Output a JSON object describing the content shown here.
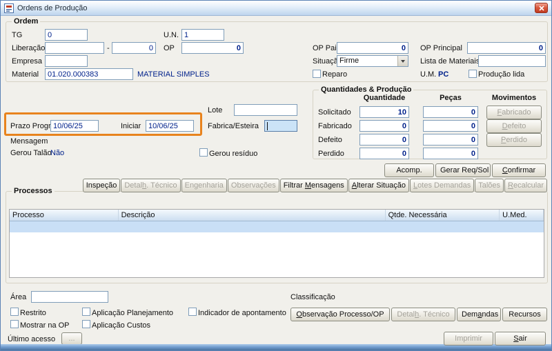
{
  "window": {
    "title": "Ordens de Produção"
  },
  "colors": {
    "annotation_highlight": "#E8831D",
    "field_value_text": "#00218B",
    "focused_field_bg": "#CBE3F7",
    "selected_row_bg": "#C9DFF6"
  },
  "ordem": {
    "label": "Ordem",
    "tg_label": "TG",
    "tg_value": "0",
    "un_label": "U.N.",
    "un_value": "1",
    "liberacao_label": "Liberação",
    "liberacao_value1": "",
    "liberacao_sep": "-",
    "liberacao_value2": "0",
    "op_label": "OP",
    "op_value": "0",
    "op_pai_label": "OP Pai",
    "op_pai_value": "0",
    "op_principal_label": "OP Principal",
    "op_principal_value": "0",
    "empresa_label": "Empresa",
    "empresa_value": "",
    "situacao_label": "Situação",
    "situacao_value": "Firme",
    "lista_label": "Lista de Materiais",
    "lista_value": "",
    "material_label": "Material",
    "material_value": "01.020.000383",
    "material_desc": "MATERIAL SIMPLES",
    "reparo_label": "Reparo",
    "um_label": "U.M.",
    "um_value": "PC",
    "producao_lida_label": "Produção lida"
  },
  "detalhes": {
    "lote_label": "Lote",
    "lote_value": "",
    "fabrica_label": "Fabrica/Esteira",
    "fabrica_value": "",
    "prazo_label": "Prazo Progr.",
    "prazo_value": "10/06/25",
    "iniciar_label": "Iniciar",
    "iniciar_value": "10/06/25",
    "mensagem_label": "Mensagem",
    "gerou_talao_label": "Gerou Talão",
    "gerou_talao_value": "Não",
    "gerou_residuo_label": "Gerou resíduo"
  },
  "quantidades": {
    "label": "Quantidades & Produção",
    "col_quantidade": "Quantidade",
    "col_pecas": "Peças",
    "col_movimentos": "Movimentos",
    "rows": [
      {
        "label": "Solicitado",
        "quantidade": "10",
        "pecas": "0"
      },
      {
        "label": "Fabricado",
        "quantidade": "0",
        "pecas": "0"
      },
      {
        "label": "Defeito",
        "quantidade": "0",
        "pecas": "0"
      },
      {
        "label": "Perdido",
        "quantidade": "0",
        "pecas": "0"
      }
    ],
    "mov_buttons": [
      {
        "label": "Fabricado",
        "key": "F",
        "enabled": false
      },
      {
        "label": "Defeito",
        "key": "D",
        "enabled": false
      },
      {
        "label": "Perdido",
        "key": "P",
        "enabled": false
      }
    ]
  },
  "order_actions": [
    {
      "label": "Acomp.",
      "enabled": true
    },
    {
      "label": "Gerar Req/Sol",
      "enabled": true
    },
    {
      "label": "Confirmar",
      "key": "C",
      "enabled": true
    }
  ],
  "toolbar": [
    {
      "label": "Inspeção",
      "enabled": true
    },
    {
      "label": "Detalh. Técnico",
      "key": "h",
      "enabled": false
    },
    {
      "label": "Engenharia",
      "enabled": false
    },
    {
      "label": "Observações",
      "enabled": false
    },
    {
      "label": "Filtrar Mensagens",
      "key": "M",
      "enabled": true
    },
    {
      "label": "Alterar Situação",
      "key": "A",
      "enabled": true
    },
    {
      "label": "Lotes Demandas",
      "key": "L",
      "enabled": false
    },
    {
      "label": "Talões",
      "enabled": false
    },
    {
      "label": "Recalcular",
      "key": "R",
      "enabled": false
    }
  ],
  "processos": {
    "label": "Processos",
    "columns": [
      "Processo",
      "Descrição",
      "Qtde. Necessária",
      "U.Med."
    ],
    "rows": [
      {
        "processo": "",
        "descricao": "",
        "qtde_necessaria": "",
        "u_med": "",
        "selected": true
      }
    ]
  },
  "rodape": {
    "area_label": "Área",
    "area_value": "",
    "classificacao_label": "Classificação",
    "restrito": "Restrito",
    "aplicacao_planejamento": "Aplicação Planejamento",
    "indicador_apontamento": "Indicador de apontamento",
    "mostrar_na_op": "Mostrar na OP",
    "aplicacao_custos": "Aplicação Custos"
  },
  "process_actions": [
    {
      "label": "Observação Processo/OP",
      "key": "O",
      "enabled": true
    },
    {
      "label": "Detalh. Técnico",
      "key": "h",
      "enabled": false
    },
    {
      "label": "Demandas",
      "key": "a",
      "enabled": true
    },
    {
      "label": "Recursos",
      "enabled": true
    }
  ],
  "footer": {
    "ultimo_acesso_label": "Último acesso",
    "dots_button": "...",
    "actions": [
      {
        "label": "Imprimir",
        "enabled": false
      },
      {
        "label": "Sair",
        "key": "S",
        "enabled": true
      }
    ]
  }
}
